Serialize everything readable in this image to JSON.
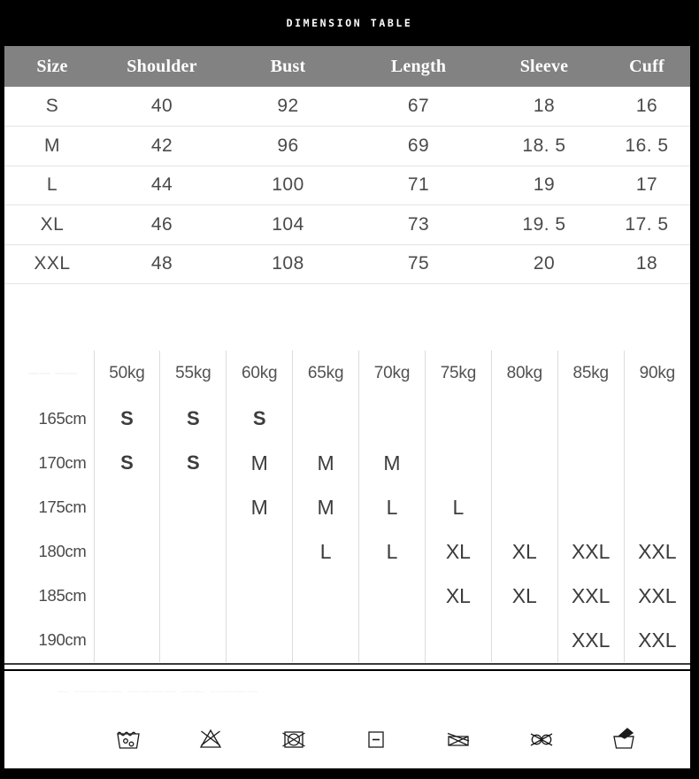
{
  "title": "DIMENSION TABLE",
  "colors": {
    "frame": "#000000",
    "header_gray": "#828282",
    "text_gray": "#4a4a4a",
    "rule_light": "#e3e3e3",
    "rule_dark": "#3a3a3a"
  },
  "dimension_table": {
    "columns": [
      "Size",
      "Shoulder",
      "Bust",
      "Length",
      "Sleeve",
      "Cuff"
    ],
    "rows": [
      {
        "size": "S",
        "shoulder": "40",
        "bust": "92",
        "length": "67",
        "sleeve": "18",
        "cuff": "16"
      },
      {
        "size": "M",
        "shoulder": "42",
        "bust": "96",
        "length": "69",
        "sleeve": "18. 5",
        "cuff": "16. 5"
      },
      {
        "size": "L",
        "shoulder": "44",
        "bust": "100",
        "length": "71",
        "sleeve": "19",
        "cuff": "17"
      },
      {
        "size": "XL",
        "shoulder": "46",
        "bust": "104",
        "length": "73",
        "sleeve": "19. 5",
        "cuff": "17. 5"
      },
      {
        "size": "XXL",
        "shoulder": "48",
        "bust": "108",
        "length": "75",
        "sleeve": "20",
        "cuff": "18"
      }
    ]
  },
  "size_grid": {
    "corner_ghost": "—— ——",
    "weights": [
      "50kg",
      "55kg",
      "60kg",
      "65kg",
      "70kg",
      "75kg",
      "80kg",
      "85kg",
      "90kg"
    ],
    "heights": [
      "165cm",
      "170cm",
      "175cm",
      "180cm",
      "185cm",
      "190cm"
    ],
    "cells": [
      [
        "S",
        "S",
        "S",
        "",
        "",
        "",
        "",
        "",
        ""
      ],
      [
        "S",
        "S",
        "M",
        "M",
        "M",
        "",
        "",
        "",
        ""
      ],
      [
        "",
        "",
        "M",
        "M",
        "L",
        "L",
        "",
        "",
        ""
      ],
      [
        "",
        "",
        "",
        "L",
        "L",
        "XL",
        "XL",
        "XXL",
        "XXL"
      ],
      [
        "",
        "",
        "",
        "",
        "",
        "XL",
        "XL",
        "XXL",
        "XXL"
      ],
      [
        "",
        "",
        "",
        "",
        "",
        "",
        "",
        "XXL",
        "XXL"
      ]
    ]
  },
  "care": {
    "ghost_note": "— ———— ———— —— ————",
    "symbols": [
      {
        "name": "wash-tub-icon",
        "label": "Machine wash"
      },
      {
        "name": "do-not-bleach-icon",
        "label": "Do not bleach"
      },
      {
        "name": "do-not-tumble-dry-icon",
        "label": "Do not tumble dry"
      },
      {
        "name": "iron-low-heat-icon",
        "label": "Iron low heat"
      },
      {
        "name": "do-not-wring-icon",
        "label": "Do not wring"
      },
      {
        "name": "do-not-dry-clean-icon",
        "label": "Do not dry clean"
      },
      {
        "name": "hand-wash-icon",
        "label": "Hand wash"
      }
    ]
  }
}
